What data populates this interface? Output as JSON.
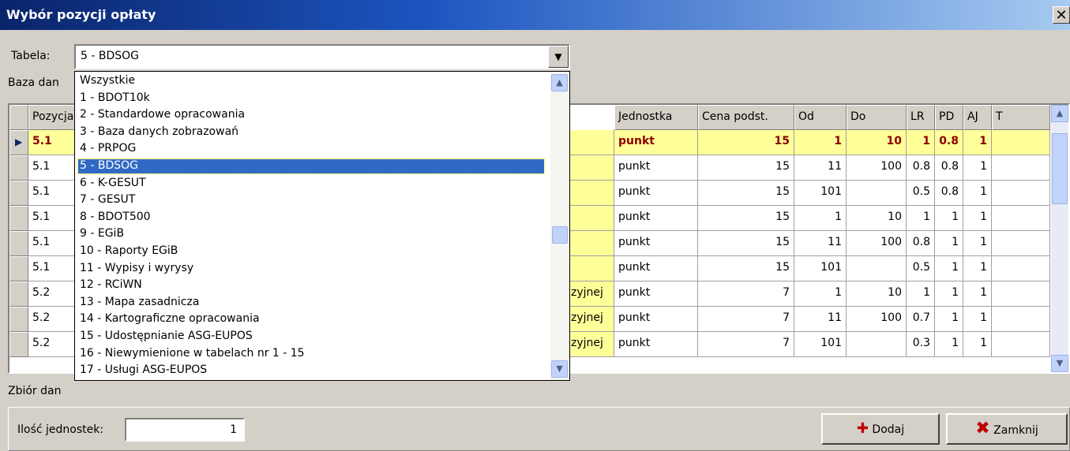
{
  "window": {
    "title": "Wybór pozycji opłaty"
  },
  "table_field": {
    "label": "Tabela:",
    "value": "5 - BDSOG"
  },
  "baza_label": "Baza dan",
  "zbior_label": "Zbiór dan",
  "grid": {
    "columns": [
      "Pozycja",
      "",
      "Jednostka",
      "Cena podst.",
      "Od",
      "Do",
      "LR",
      "PD",
      "AJ",
      "T"
    ],
    "rows": [
      {
        "poz": "5.1",
        "opis": "",
        "jednostka": "punkt",
        "cena": "15",
        "od": "1",
        "do": "10",
        "lr": "1",
        "pd": "0.8",
        "aj": "1",
        "t": ""
      },
      {
        "poz": "5.1",
        "opis": "",
        "jednostka": "punkt",
        "cena": "15",
        "od": "11",
        "do": "100",
        "lr": "0.8",
        "pd": "0.8",
        "aj": "1",
        "t": ""
      },
      {
        "poz": "5.1",
        "opis": "",
        "jednostka": "punkt",
        "cena": "15",
        "od": "101",
        "do": "",
        "lr": "0.5",
        "pd": "0.8",
        "aj": "1",
        "t": ""
      },
      {
        "poz": "5.1",
        "opis": "",
        "jednostka": "punkt",
        "cena": "15",
        "od": "1",
        "do": "10",
        "lr": "1",
        "pd": "1",
        "aj": "1",
        "t": ""
      },
      {
        "poz": "5.1",
        "opis": "",
        "jednostka": "punkt",
        "cena": "15",
        "od": "11",
        "do": "100",
        "lr": "0.8",
        "pd": "1",
        "aj": "1",
        "t": ""
      },
      {
        "poz": "5.1",
        "opis": "",
        "jednostka": "punkt",
        "cena": "15",
        "od": "101",
        "do": "",
        "lr": "0.5",
        "pd": "1",
        "aj": "1",
        "t": ""
      },
      {
        "poz": "5.2",
        "opis": "zyjnej",
        "jednostka": "punkt",
        "cena": "7",
        "od": "1",
        "do": "10",
        "lr": "1",
        "pd": "1",
        "aj": "1",
        "t": ""
      },
      {
        "poz": "5.2",
        "opis": "zyjnej",
        "jednostka": "punkt",
        "cena": "7",
        "od": "11",
        "do": "100",
        "lr": "0.7",
        "pd": "1",
        "aj": "1",
        "t": ""
      },
      {
        "poz": "5.2",
        "opis": "zyjnej",
        "jednostka": "punkt",
        "cena": "7",
        "od": "101",
        "do": "",
        "lr": "0.3",
        "pd": "1",
        "aj": "1",
        "t": ""
      }
    ]
  },
  "dropdown": {
    "items": [
      "Wszystkie",
      "1 - BDOT10k",
      "2 - Standardowe opracowania",
      "3 - Baza danych zobrazowań",
      "4 - PRPOG",
      "5 - BDSOG",
      "6 - K-GESUT",
      "7 - GESUT",
      "8 - BDOT500",
      "9 - EGiB",
      "10 - Raporty EGiB",
      "11 - Wypisy i wyrysy",
      "12 - RCiWN",
      "13 - Mapa zasadnicza",
      "14 - Kartograficzne opracowania",
      "15 - Udostępnianie ASG-EUPOS",
      "16 - Niewymienione w tabelach nr 1 - 15",
      "17 - Usługi ASG-EUPOS"
    ],
    "selected_index": 5
  },
  "bottom": {
    "qty_label": "Ilość jednostek:",
    "qty_value": "1",
    "add_label": "Dodaj",
    "close_label": "Zamknij"
  }
}
